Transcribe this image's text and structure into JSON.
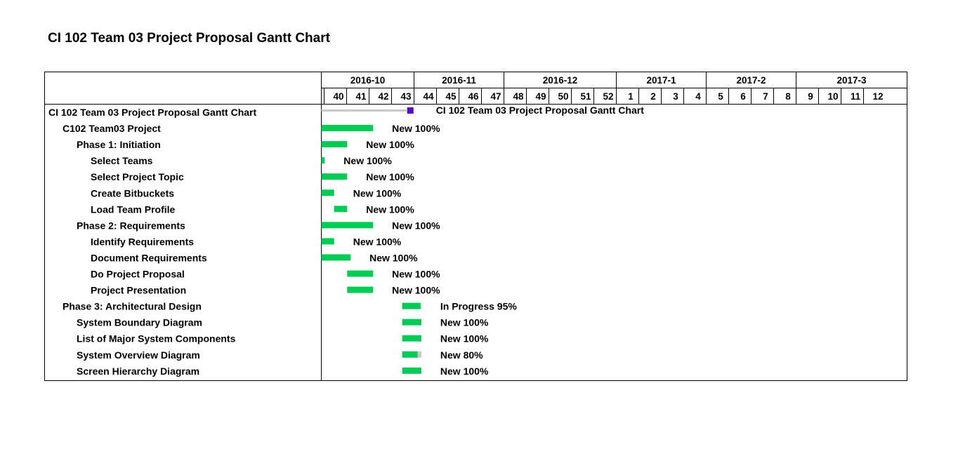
{
  "page_title": "CI 102 Team 03 Project Proposal Gantt Chart",
  "chart_data": {
    "type": "gantt",
    "title": "CI 102 Team 03 Project Proposal Gantt Chart",
    "months": [
      {
        "label": "2016-10",
        "weeks": [
          "40",
          "41",
          "42",
          "43"
        ]
      },
      {
        "label": "2016-11",
        "weeks": [
          "44",
          "45",
          "46",
          "47"
        ]
      },
      {
        "label": "2016-12",
        "weeks": [
          "48",
          "49",
          "50",
          "51",
          "52"
        ]
      },
      {
        "label": "2017-1",
        "weeks": [
          "1",
          "2",
          "3",
          "4"
        ]
      },
      {
        "label": "2017-2",
        "weeks": [
          "5",
          "6",
          "7",
          "8"
        ]
      },
      {
        "label": "2017-3",
        "weeks": [
          "9",
          "10",
          "11",
          "12"
        ]
      }
    ],
    "colors": {
      "complete": "#00cc55",
      "remaining": "#c8c8c8",
      "summary_bar": "#c8c8c8",
      "milestone": "#5500cc"
    },
    "tasks": [
      {
        "name": "CI 102 Team 03 Project Proposal Gantt Chart",
        "level": 0,
        "kind": "project",
        "start_week": 0,
        "end_week": 4.1,
        "label": "CI 102 Team 03 Project Proposal Gantt Chart"
      },
      {
        "name": "C102 Team03 Project",
        "level": 1,
        "kind": "task",
        "start_week": 0,
        "end_week": 2.3,
        "progress": 1.0,
        "label": "New 100%"
      },
      {
        "name": "Phase 1: Initiation",
        "level": 2,
        "kind": "task",
        "start_week": 0,
        "end_week": 1.15,
        "progress": 1.0,
        "label": "New 100%"
      },
      {
        "name": "Select Teams",
        "level": 3,
        "kind": "task",
        "start_week": 0,
        "end_week": 0.15,
        "progress": 1.0,
        "label": "New 100%"
      },
      {
        "name": "Select Project Topic",
        "level": 3,
        "kind": "task",
        "start_week": 0,
        "end_week": 1.15,
        "progress": 1.0,
        "label": "New 100%"
      },
      {
        "name": "Create Bitbuckets",
        "level": 3,
        "kind": "task",
        "start_week": 0,
        "end_week": 0.57,
        "progress": 1.0,
        "label": "New 100%"
      },
      {
        "name": "Load Team Profile",
        "level": 3,
        "kind": "task",
        "start_week": 0.57,
        "end_week": 1.15,
        "progress": 1.0,
        "label": "New 100%"
      },
      {
        "name": "Phase 2: Requirements",
        "level": 2,
        "kind": "task",
        "start_week": 0,
        "end_week": 2.3,
        "progress": 1.0,
        "label": "New 100%"
      },
      {
        "name": "Identify Requirements",
        "level": 3,
        "kind": "task",
        "start_week": 0,
        "end_week": 0.57,
        "progress": 1.0,
        "label": "New 100%"
      },
      {
        "name": "Document Requirements",
        "level": 3,
        "kind": "task",
        "start_week": 0,
        "end_week": 1.3,
        "progress": 1.0,
        "label": "New 100%"
      },
      {
        "name": "Do Project Proposal",
        "level": 3,
        "kind": "task",
        "start_week": 1.15,
        "end_week": 2.3,
        "progress": 1.0,
        "label": "New 100%"
      },
      {
        "name": "Project Presentation",
        "level": 3,
        "kind": "task",
        "start_week": 1.15,
        "end_week": 2.3,
        "progress": 1.0,
        "label": "New 100%"
      },
      {
        "name": "Phase 3: Architectural Design",
        "level": 1,
        "kind": "task",
        "start_week": 3.6,
        "end_week": 4.45,
        "progress": 0.95,
        "label": "In Progress 95%"
      },
      {
        "name": "System Boundary Diagram",
        "level": 2,
        "kind": "task",
        "start_week": 3.6,
        "end_week": 4.45,
        "progress": 1.0,
        "label": "New 100%"
      },
      {
        "name": "List of Major System Components",
        "level": 2,
        "kind": "task",
        "start_week": 3.6,
        "end_week": 4.45,
        "progress": 1.0,
        "label": "New 100%"
      },
      {
        "name": "System Overview Diagram",
        "level": 2,
        "kind": "task",
        "start_week": 3.6,
        "end_week": 4.45,
        "progress": 0.8,
        "label": "New 80%"
      },
      {
        "name": "Screen Hierarchy Diagram",
        "level": 2,
        "kind": "task",
        "start_week": 3.6,
        "end_week": 4.45,
        "progress": 1.0,
        "label": "New 100%"
      }
    ]
  }
}
